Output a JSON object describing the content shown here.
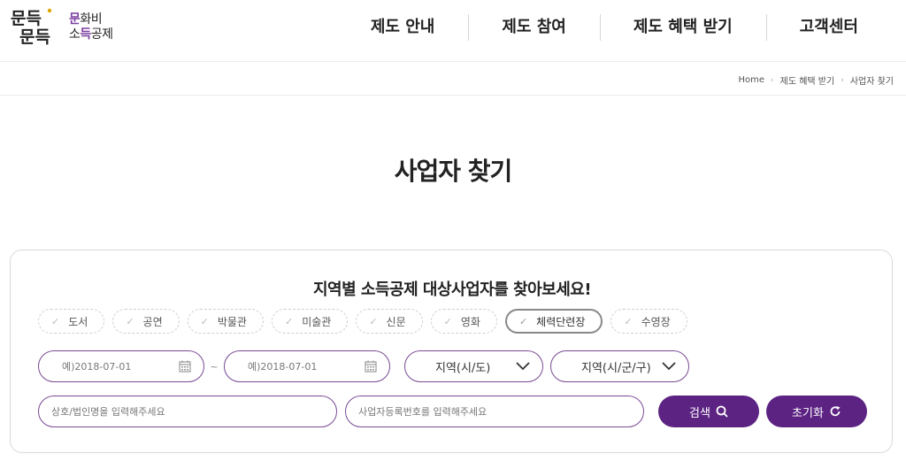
{
  "logo": {
    "mark_line1": "문득",
    "mark_line2": "문득",
    "text_line1_hl": "문",
    "text_line1_rest": "화비",
    "text_line2_pre": "소",
    "text_line2_hl": "득",
    "text_line2_rest": "공제"
  },
  "nav": {
    "items": [
      {
        "label": "제도 안내"
      },
      {
        "label": "제도 참여"
      },
      {
        "label": "제도 혜택 받기"
      },
      {
        "label": "고객센터"
      }
    ]
  },
  "breadcrumb": {
    "items": [
      "Home",
      "제도 혜택 받기",
      "사업자 찾기"
    ]
  },
  "page": {
    "title": "사업자 찾기"
  },
  "search": {
    "heading": "지역별 소득공제 대상사업자를 찾아보세요!",
    "categories": [
      {
        "label": "도서",
        "active": false
      },
      {
        "label": "공연",
        "active": false
      },
      {
        "label": "박물관",
        "active": false
      },
      {
        "label": "미술관",
        "active": false
      },
      {
        "label": "신문",
        "active": false
      },
      {
        "label": "영화",
        "active": false
      },
      {
        "label": "체력단련장",
        "active": true
      },
      {
        "label": "수영장",
        "active": false
      }
    ],
    "date_from_placeholder": "예)2018-07-01",
    "date_sep": "~",
    "date_to_placeholder": "예)2018-07-01",
    "region_sido": "지역(시/도)",
    "region_sigungu": "지역(시/군/구)",
    "name_placeholder": "상호/법인명을 입력해주세요",
    "bizno_placeholder": "사업자등록번호를 입력해주세요",
    "search_label": "검색",
    "reset_label": "초기화"
  },
  "colors": {
    "brand": "#5c2383",
    "border_accent": "#7a4a94",
    "logo_highlight": "#7b3fa0"
  },
  "icons": {
    "check": "check-icon",
    "calendar": "calendar-icon",
    "chevron": "chevron-down-icon",
    "search": "search-icon",
    "reset": "refresh-icon"
  }
}
